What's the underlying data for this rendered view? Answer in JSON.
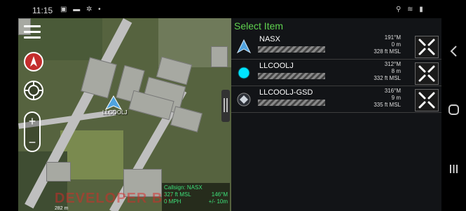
{
  "status_bar": {
    "time": "11:15",
    "left_icons": "▣ ▬ ✲ •",
    "right_icons": "⚲ ≋ ▮"
  },
  "map": {
    "self_label": "LLCOOLJ",
    "info": {
      "callsign": "Callsign: NASX",
      "altitude": "327 ft MSL",
      "heading": "146°M",
      "speed": "0 MPH",
      "accuracy": "+/- 10m"
    },
    "watermark": "DEVELOPER BU",
    "scale_text": "282 m"
  },
  "panel": {
    "title": "Select Item",
    "items": [
      {
        "name": "NASX",
        "bearing": "191°M",
        "range": "0 m",
        "altitude": "328 ft MSL",
        "icon": "blue-arrow-icon"
      },
      {
        "name": "LLCOOLJ",
        "bearing": "312°M",
        "range": "8 m",
        "altitude": "332 ft MSL",
        "icon": "cyan-dot-icon"
      },
      {
        "name": "LLCOOLJ-GSD",
        "bearing": "316°M",
        "range": "9 m",
        "altitude": "335 ft MSL",
        "icon": "gsd-diamond-icon"
      }
    ]
  },
  "colors": {
    "title_green": "#5fd14f",
    "info_green": "#3ee07a",
    "self_marker_blue": "#4fa3e0",
    "cyan_dot": "#00e5ff"
  }
}
